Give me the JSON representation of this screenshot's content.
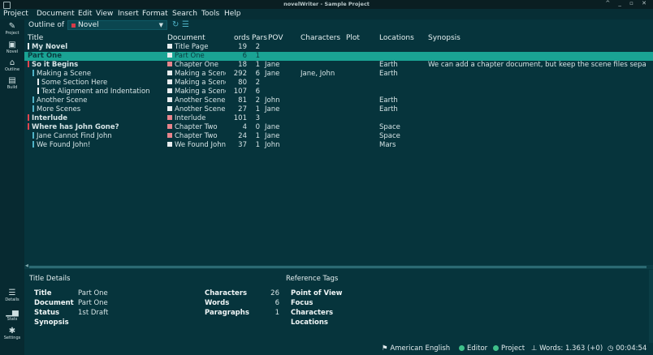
{
  "window": {
    "title": "novelWriter - Sample Project",
    "controls": "^ _ ▫ ✕"
  },
  "menu": [
    "Project",
    "Document",
    "Edit",
    "View",
    "Insert",
    "Format",
    "Search",
    "Tools",
    "Help"
  ],
  "sidebar": [
    {
      "label": "Project",
      "icon": "project-icon"
    },
    {
      "label": "Novel",
      "icon": "novel-icon"
    },
    {
      "label": "Outline",
      "icon": "outline-icon"
    },
    {
      "label": "Build",
      "icon": "build-icon"
    },
    {
      "label": "Details",
      "icon": "details-icon"
    },
    {
      "label": "Stats",
      "icon": "stats-icon"
    },
    {
      "label": "Settings",
      "icon": "settings-icon"
    }
  ],
  "toolbar": {
    "outline_label": "Outline of",
    "novel_select": "Novel"
  },
  "columns": [
    "Title",
    "Document",
    "ords",
    "Pars",
    "POV",
    "Characters",
    "Plot",
    "Locations",
    "Synopsis"
  ],
  "rows": [
    {
      "title": "My Novel",
      "bold": true,
      "indent": 0,
      "marker": "#e8eef0",
      "doc": "Title Page",
      "doc_red": false,
      "words": "19",
      "pars": "2",
      "pov": "",
      "characters": "",
      "plot": "",
      "locations": "",
      "synopsis": ""
    },
    {
      "title": "Part One",
      "bold": true,
      "indent": 0,
      "marker": "",
      "doc": "Part One",
      "doc_red": false,
      "words": "6",
      "pars": "1",
      "pov": "",
      "characters": "",
      "plot": "",
      "locations": "",
      "synopsis": "",
      "selected": true
    },
    {
      "title": "So it Begins",
      "bold": true,
      "indent": 0,
      "marker": "#e0444f",
      "doc": "Chapter One",
      "doc_red": true,
      "words": "18",
      "pars": "1",
      "pov": "Jane",
      "characters": "",
      "plot": "",
      "locations": "Earth",
      "synopsis": "We can add a chapter document, but keep the scene files sepa"
    },
    {
      "title": "Making a Scene",
      "bold": false,
      "indent": 1,
      "marker": "#4fb3c7",
      "doc": "Making a Scene",
      "doc_red": false,
      "words": "292",
      "pars": "6",
      "pov": "Jane",
      "characters": "Jane, John",
      "plot": "",
      "locations": "Earth",
      "synopsis": ""
    },
    {
      "title": "Some Section Here",
      "bold": false,
      "indent": 2,
      "marker": "#e8eef0",
      "doc": "Making a Scene",
      "doc_red": false,
      "words": "80",
      "pars": "2",
      "pov": "",
      "characters": "",
      "plot": "",
      "locations": "",
      "synopsis": ""
    },
    {
      "title": "Text Alignment and Indentation",
      "bold": false,
      "indent": 2,
      "marker": "#e8eef0",
      "doc": "Making a Scene",
      "doc_red": false,
      "words": "107",
      "pars": "6",
      "pov": "",
      "characters": "",
      "plot": "",
      "locations": "",
      "synopsis": ""
    },
    {
      "title": "Another Scene",
      "bold": false,
      "indent": 1,
      "marker": "#4fb3c7",
      "doc": "Another Scene",
      "doc_red": false,
      "words": "81",
      "pars": "2",
      "pov": "John",
      "characters": "",
      "plot": "",
      "locations": "Earth",
      "synopsis": ""
    },
    {
      "title": "More Scenes",
      "bold": false,
      "indent": 1,
      "marker": "#4fb3c7",
      "doc": "Another Scene",
      "doc_red": false,
      "words": "27",
      "pars": "1",
      "pov": "Jane",
      "characters": "",
      "plot": "",
      "locations": "Earth",
      "synopsis": ""
    },
    {
      "title": "Interlude",
      "bold": true,
      "indent": 0,
      "marker": "#e0444f",
      "doc": "Interlude",
      "doc_red": true,
      "words": "101",
      "pars": "3",
      "pov": "",
      "characters": "",
      "plot": "",
      "locations": "",
      "synopsis": ""
    },
    {
      "title": "Where has John Gone?",
      "bold": true,
      "indent": 0,
      "marker": "#e0444f",
      "doc": "Chapter Two",
      "doc_red": true,
      "words": "4",
      "pars": "0",
      "pov": "Jane",
      "characters": "",
      "plot": "",
      "locations": "Space",
      "synopsis": ""
    },
    {
      "title": "Jane Cannot Find John",
      "bold": false,
      "indent": 1,
      "marker": "#4fb3c7",
      "doc": "Chapter Two",
      "doc_red": true,
      "words": "24",
      "pars": "1",
      "pov": "Jane",
      "characters": "",
      "plot": "",
      "locations": "Space",
      "synopsis": ""
    },
    {
      "title": "We Found John!",
      "bold": false,
      "indent": 1,
      "marker": "#4fb3c7",
      "doc": "We Found John!",
      "doc_red": false,
      "words": "37",
      "pars": "1",
      "pov": "John",
      "characters": "",
      "plot": "",
      "locations": "Mars",
      "synopsis": ""
    }
  ],
  "details": {
    "title_details_heading": "Title Details",
    "labels": {
      "title": "Title",
      "document": "Document",
      "status": "Status",
      "synopsis": "Synopsis"
    },
    "values": {
      "title": "Part One",
      "document": "Part One",
      "status": "1st Draft"
    },
    "counts": [
      {
        "label": "Characters",
        "value": "26"
      },
      {
        "label": "Words",
        "value": "6"
      },
      {
        "label": "Paragraphs",
        "value": "1"
      }
    ],
    "reference_heading": "Reference Tags",
    "reference_tags": [
      "Point of View",
      "Focus",
      "Characters",
      "Locations"
    ]
  },
  "status": {
    "language": "American English",
    "editor": "Editor",
    "project": "Project",
    "words": "Words: 1.363 (+0)",
    "time": "00:04:54"
  },
  "colors": {
    "accent": "#1aa394",
    "background": "#06343c",
    "status_green": "#3fc08a",
    "chapter_red": "#e0444f"
  }
}
